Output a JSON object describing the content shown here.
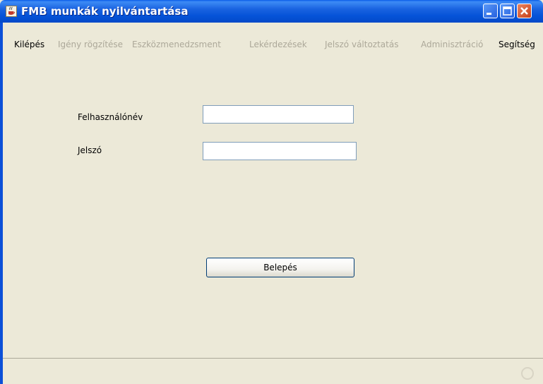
{
  "window": {
    "title": "FMB munkák nyilvántartása",
    "colors": {
      "titlebar": "#0553d8",
      "close": "#c8401a",
      "background": "#ece9d8"
    }
  },
  "menu": [
    {
      "label": "Kilépés",
      "enabled": true
    },
    {
      "label": "Igény rögzítése",
      "enabled": false
    },
    {
      "label": "Eszközmenedzsment",
      "enabled": false
    },
    {
      "label": "Lekérdezések",
      "enabled": false
    },
    {
      "label": "Jelszó változtatás",
      "enabled": false
    },
    {
      "label": "Adminisztráció",
      "enabled": false
    },
    {
      "label": "Segítség",
      "enabled": true
    }
  ],
  "form": {
    "username_label": "Felhasználónév",
    "username_value": "",
    "password_label": "Jelszó",
    "password_value": "",
    "login_button": "Belepés"
  },
  "icons": {
    "app": "java-cup-icon",
    "minimize": "minimize-icon",
    "maximize": "maximize-icon",
    "close": "close-icon",
    "status": "busy-indicator-icon"
  }
}
